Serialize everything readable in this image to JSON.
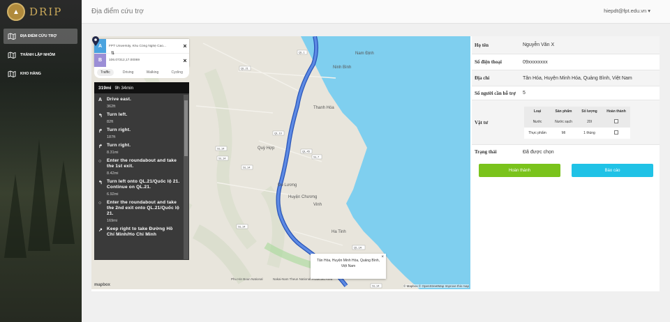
{
  "app": {
    "logo_text": "DRIP",
    "logo_icon": "mountain-logo-icon"
  },
  "sidebar": {
    "items": [
      {
        "label": "ĐỊA ĐIỂM CỨU TRỢ",
        "icon": "map-icon",
        "active": true
      },
      {
        "label": "THÀNH LẬP NHÓM",
        "icon": "map-icon",
        "active": false
      },
      {
        "label": "KHO HÀNG",
        "icon": "map-icon",
        "active": false
      }
    ]
  },
  "header": {
    "title": "Địa điểm cứu trợ",
    "user": "hiepdt@fpt.edu.vn"
  },
  "map": {
    "origin_badge": "A",
    "origin": "FPT University, Khu Công Nghệ Cao...",
    "destination_badge": "B",
    "destination": "106.07312,17.00069",
    "modes": [
      "Traffic",
      "Driving",
      "Walking",
      "Cycling"
    ],
    "active_mode": "Traffic",
    "summary_distance": "319mi",
    "summary_time": "9h 34min",
    "steps": [
      {
        "icon": "A",
        "text": "Drive east.",
        "dist": "362ft"
      },
      {
        "icon": "↰",
        "text": "Turn left.",
        "dist": "82ft"
      },
      {
        "icon": "↱",
        "text": "Turn right.",
        "dist": "187ft"
      },
      {
        "icon": "↱",
        "text": "Turn right.",
        "dist": "8.31mi"
      },
      {
        "icon": "○",
        "text": "Enter the roundabout and take the 1st exit.",
        "dist": "8.42mi"
      },
      {
        "icon": "↰",
        "text": "Turn left onto QL.21/Quốc lộ 21. Continue on QL.21.",
        "dist": "6.92mi"
      },
      {
        "icon": "○",
        "text": "Enter the roundabout and take the 2nd exit onto QL.21/Quốc lộ 21.",
        "dist": "169mi"
      },
      {
        "icon": "↗",
        "text": "Keep right to take Đường Hồ Chí Minh/Ho Chi Minh",
        "dist": ""
      }
    ],
    "place_labels": [
      {
        "text": "Nam Định"
      },
      {
        "text": "Ninh Bình"
      },
      {
        "text": "Thanh Hóa"
      },
      {
        "text": "Quỳ Hợp"
      },
      {
        "text": "Đo Lương"
      },
      {
        "text": "Huyện Chương"
      },
      {
        "text": "Vinh"
      },
      {
        "text": "Ha Tinh"
      },
      {
        "text": "Phu Hin Boun National"
      },
      {
        "text": "Nakai-Nam Theun National Protected Area"
      }
    ],
    "road_labels": [
      "QL.21",
      "QL.1",
      "SL.14",
      "QL.10",
      "QL.45",
      "SL.7",
      "SL.14",
      "SL.14",
      "SL.14",
      "13A",
      "QL.1A",
      "SL.14"
    ],
    "popup_text": "Tân Hóa, Huyện Minh Hóa, Quảng Bình, Việt Nam",
    "popup_close": "×",
    "mapbox_logo": "mapbox",
    "attribution": "© Mapbox © OpenStreetMap Improve this map"
  },
  "details": {
    "name_label": "Họ tên",
    "name": "Nguyễn Văn X",
    "phone_label": "Số điện thoại",
    "phone": "09xxxxxxxx",
    "address_label": "Địa chỉ",
    "address": "Tân Hóa, Huyện Minh Hóa, Quảng Bình, Việt Nam",
    "people_label": "Số người cần hỗ trợ",
    "people": "5",
    "supplies_label": "Vật tư",
    "supplies_headers": [
      "Loại",
      "Sản phẩm",
      "Số lượng",
      "Hoàn thành"
    ],
    "supplies": [
      {
        "type": "Nước",
        "product": "Nước sạch",
        "qty": "20l"
      },
      {
        "type": "Thực phẩm",
        "product": "Mì",
        "qty": "1 thùng"
      }
    ],
    "status_label": "Trạng thái",
    "status": "Đã được chọn"
  },
  "actions": {
    "done": "Hoàn thành",
    "report": "Báo cáo"
  },
  "colors": {
    "accent_green": "#7ac31c",
    "accent_blue": "#20c2e6",
    "route": "#3b6fd6",
    "sea": "#7fcfef",
    "badge_a": "#4aa3df",
    "badge_b": "#9b8ed6"
  }
}
